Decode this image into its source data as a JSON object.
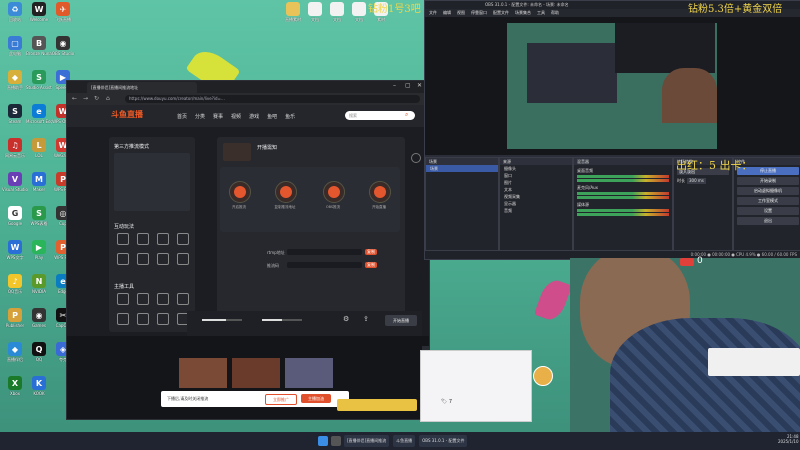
{
  "overlay_text": {
    "top_center": "钻粉1号3吧",
    "top_right": "钻粉5.3倍+黄金双倍",
    "right_middle": "出红：5 出卡："
  },
  "desktop_icons": [
    {
      "label": "回收站",
      "color": "#3b8bd6",
      "glyph": "♻"
    },
    {
      "label": "Welcome",
      "color": "#222",
      "glyph": "W"
    },
    {
      "label": "飞跃直播",
      "color": "#e05a2a",
      "glyph": "✈"
    },
    {
      "label": "此电脑",
      "color": "#3a7bd5",
      "glyph": "▢"
    },
    {
      "label": "Bronze Nuna",
      "color": "#555",
      "glyph": "B"
    },
    {
      "label": "OBS Studio",
      "color": "#333",
      "glyph": "◉"
    },
    {
      "label": "直播助手",
      "color": "#d6b03a",
      "glyph": "◆"
    },
    {
      "label": "Studio Assistant",
      "color": "#2a9a5a",
      "glyph": "S"
    },
    {
      "label": "Speedp",
      "color": "#3b6fd6",
      "glyph": "▶"
    },
    {
      "label": "Steam",
      "color": "#1b2838",
      "glyph": "S"
    },
    {
      "label": "Microsoft Edge",
      "color": "#0c7dd6",
      "glyph": "e"
    },
    {
      "label": "WPS Office",
      "color": "#c2322b",
      "glyph": "W"
    },
    {
      "label": "网易云音乐",
      "color": "#c9302c",
      "glyph": "♫"
    },
    {
      "label": "LOL",
      "color": "#c59a3b",
      "glyph": "L"
    },
    {
      "label": "WeGame",
      "color": "#d13b2f",
      "glyph": "W"
    },
    {
      "label": "Visual Studio",
      "color": "#6a3fb5",
      "glyph": "V"
    },
    {
      "label": "Maker",
      "color": "#2a6fd6",
      "glyph": "M"
    },
    {
      "label": "WPS PDF",
      "color": "#c73b2b",
      "glyph": "P"
    },
    {
      "label": "Google",
      "color": "#fff",
      "glyph": "G"
    },
    {
      "label": "WPS表格",
      "color": "#2a9a4a",
      "glyph": "S"
    },
    {
      "label": "Cup",
      "color": "#333",
      "glyph": "◎"
    },
    {
      "label": "WPS文字",
      "color": "#2a6fd6",
      "glyph": "W"
    },
    {
      "label": "Play",
      "color": "#2ab55a",
      "glyph": "▶"
    },
    {
      "label": "WPS PPT",
      "color": "#e06030",
      "glyph": "P"
    },
    {
      "label": "QQ音乐",
      "color": "#f2c62a",
      "glyph": "♪"
    },
    {
      "label": "NVIDIA",
      "color": "#5a9a2a",
      "glyph": "N"
    },
    {
      "label": "Edge",
      "color": "#0a7dc0",
      "glyph": "e"
    },
    {
      "label": "Publisher",
      "color": "#d6a03a",
      "glyph": "P"
    },
    {
      "label": "Games",
      "color": "#333",
      "glyph": "◉"
    },
    {
      "label": "CapCut",
      "color": "#111",
      "glyph": "✂"
    },
    {
      "label": "直播伴侣",
      "color": "#2a8ad6",
      "glyph": "◆"
    },
    {
      "label": "QQ",
      "color": "#111",
      "glyph": "Q"
    },
    {
      "label": "夸克",
      "color": "#3a6ad6",
      "glyph": "◈"
    },
    {
      "label": "Xbox",
      "color": "#1a7a2a",
      "glyph": "X"
    },
    {
      "label": "KOOK",
      "color": "#2a6fd6",
      "glyph": "K"
    }
  ],
  "top_files": [
    {
      "label": "直播素材"
    },
    {
      "label": "文档"
    },
    {
      "label": "文档"
    },
    {
      "label": "文档"
    },
    {
      "label": "素材"
    }
  ],
  "browser": {
    "tab_title": "[直播伴侣]直播间推流地址",
    "url": "https://www.douyu.com/creator/main/live?id=…",
    "logo": "斗鱼直播",
    "nav": [
      "首页",
      "分类",
      "赛事",
      "视频",
      "游戏",
      "鱼吧",
      "鱼乐"
    ],
    "search_placeholder": "搜索",
    "left_panel_title": "第三方推流模式",
    "center_title": "开播需知",
    "steps": [
      "开启推流",
      "复制推流地址",
      "OBS推流",
      "开始直播"
    ],
    "rtmp_label": "rtmp地址",
    "key_label": "推流码",
    "copy_label": "复制",
    "tools_title": "互动玩法",
    "tools2_title": "主播工具",
    "start_btn": "开始直播",
    "footer_banner": "下播后,请及时关闭推流",
    "footer_btn1": "立即推广",
    "footer_btn2": "主播加油"
  },
  "obs": {
    "title": "OBS 31.0.1 - 配置文件: 未命名 - 场景: 未命名",
    "menu": [
      "文件",
      "编辑",
      "视图",
      "停靠窗口",
      "配置文件",
      "场景集合",
      "工具",
      "帮助"
    ],
    "scenes_title": "场景",
    "scene_item": "场景",
    "sources_title": "来源",
    "sources": [
      "摄像头",
      "窗口",
      "图片",
      "文本",
      "视频采集",
      "显示器",
      "音频"
    ],
    "mixer_title": "混音器",
    "mixer_items": [
      "桌面音频",
      "麦克风/Aux",
      "媒体源"
    ],
    "transitions_title": "转场特效",
    "transition_value": "淡入淡出",
    "duration_label": "时长",
    "duration_value": "300 ms",
    "controls_title": "控件",
    "controls": [
      "停止直播",
      "开始录制",
      "启动虚拟摄像机",
      "工作室模式",
      "设置",
      "退出"
    ],
    "status": "0:00:00 ● 00:00:00 ● CPU 4.9% ● 60.00 / 60.00 FPS"
  },
  "taskbar": {
    "items": [
      "[直播伴侣]直播间推流",
      "斗鱼直播",
      "OBS 31.0.1 - 配置文件"
    ],
    "time": "21:48",
    "date": "2025/1/10"
  },
  "live_overlay": {
    "badge": "0",
    "danmu": "🏷 7"
  }
}
